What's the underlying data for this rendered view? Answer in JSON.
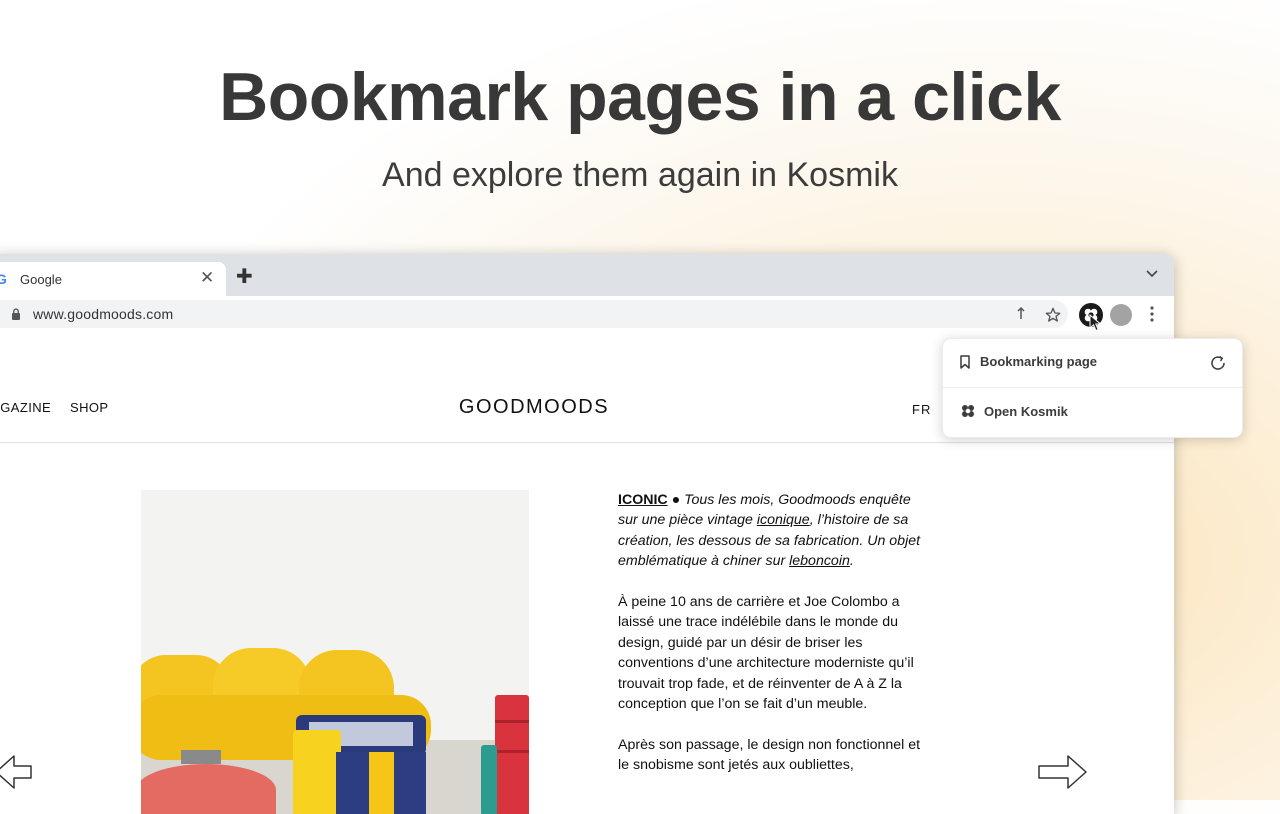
{
  "hero": {
    "title": "Bookmark pages in a click",
    "subtitle": "And explore them again in Kosmik"
  },
  "browser": {
    "tab": {
      "title": "Google",
      "favicon": "G"
    },
    "url": "www.goodmoods.com",
    "icons": [
      "lock-icon",
      "share-icon",
      "star-icon",
      "kosmik-extension-icon",
      "profile-avatar",
      "kebab-menu-icon",
      "tabs-menu-icon"
    ]
  },
  "site": {
    "nav_left": [
      "MAGAZINE",
      "SHOP"
    ],
    "logo": "GOODMOODS",
    "nav_right": "FR",
    "article": {
      "p1": {
        "label": "ICONIC",
        "bullet": " ● ",
        "t1": "Tous les mois, Goodmoods enquête sur une pièce vintage ",
        "link1": "iconique",
        "t2": ", l’histoire de sa création, les dessous de sa fabrication. Un objet emblématique à chiner sur ",
        "link2": "leboncoin",
        "t3": "."
      },
      "p2": "À peine 10 ans de carrière et Joe Colombo a laissé une trace indélébile dans le monde du design, guidé par un désir de briser les conventions d’une architecture moderniste qu’il trouvait trop fade, et de réinventer de A à Z la conception que l’on se fait d’un meuble.",
      "p3": "Après son passage, le design non fonctionnel et le snobisme sont jetés aux oubliettes,"
    }
  },
  "popup": {
    "status": "Bookmarking page",
    "open_label": "Open Kosmik"
  },
  "colors": {
    "title": "#383838",
    "tabstrip": "#dee1e6",
    "omnibox": "#f1f3f4",
    "sofa": "#f4c520"
  }
}
